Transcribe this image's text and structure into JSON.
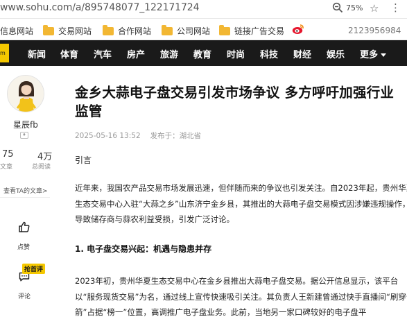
{
  "browser": {
    "url": "www.sohu.com/a/895748077_122171724",
    "zoom": "75%",
    "zoom_icon": "zoom-out-magnifier-icon",
    "star_icon": "star-outline-icon",
    "more_icon": "more-dots-icon"
  },
  "bookmarks": {
    "items": [
      "信息网站",
      "交易网站",
      "合作网站",
      "公司网站",
      "链接广告交易"
    ],
    "first_partial": "信息网站",
    "phone": "2123956984"
  },
  "nav": {
    "logo_text": "m",
    "items": [
      "新闻",
      "体育",
      "汽车",
      "房产",
      "旅游",
      "教育",
      "时尚",
      "科技",
      "财经",
      "娱乐"
    ],
    "more_label": "更多"
  },
  "author": {
    "name": "星辰fb",
    "articles_count": "75",
    "articles_label": "文章",
    "reads_count": "4万",
    "reads_label": "总阅读",
    "view_all_link": "查看TA的文章>"
  },
  "actions": {
    "like_label": "点赞",
    "hot_badge": "抢首评",
    "comment_label": "评论"
  },
  "article": {
    "title": "金乡大蒜电子盘交易引发市场争议 多方呼吁加强行业监管",
    "date": "2025-05-16 13:52",
    "source": "发布于：湖北省",
    "intro_heading": "引言",
    "para1": "近年来，我国农产品交易市场发展迅速，但伴随而来的争议也引发关注。自2023年起，贵州华夏生态交易中心入驻“大蒜之乡”山东济宁金乡县，其推出的大蒜电子盘交易模式因涉嫌违规操作，导致储存商与蒜农利益受损，引发广泛讨论。",
    "section1_heading": "1. 电子盘交易兴起：机遇与隐患并存",
    "para2": "2023年初，贵州华夏生态交易中心在金乡县推出大蒜电子盘交易。据公开信息显示，该平台以“服务现货交易”为名，通过线上宣传快速吸引关注。其负责人王新建曾通过快手直播间“刷穿云箭”占据“榜一”位置，高调推广电子盘业务。此前，当地另一家口碑较好的电子盘平"
  }
}
